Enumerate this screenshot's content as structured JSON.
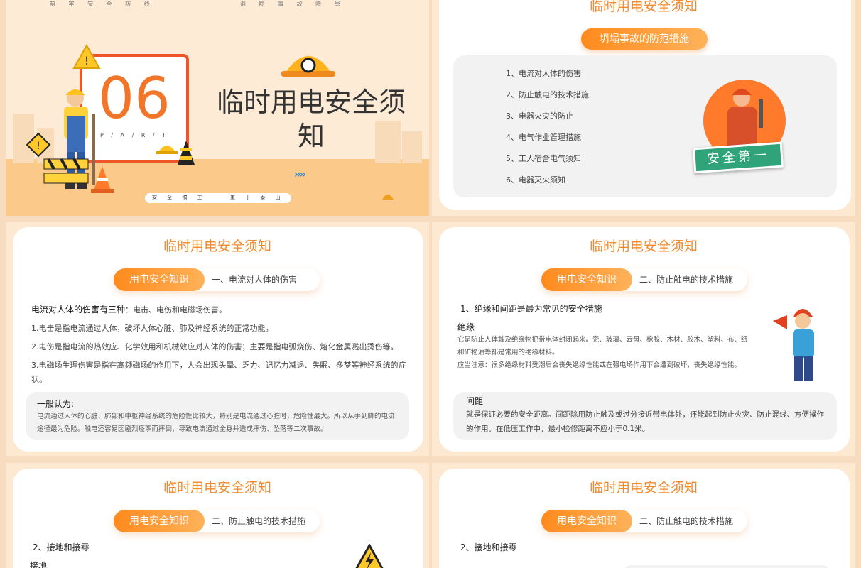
{
  "s1": {
    "top_left": "筑 牢 安 全 防 线",
    "top_right": "消 除 事 故 隐 患",
    "number": "06",
    "part": "P / A / R / T",
    "title": "临时用电安全须知",
    "bottom_left": "安 全 搞 工",
    "bottom_right": "重 于 泰 山"
  },
  "s2": {
    "title": "临时用电安全须知",
    "pill": "坍塌事故的防范措施",
    "items": [
      "1、电流对人体的伤害",
      "2、防止触电的技术措施",
      "3、电器火灾的防止",
      "4、电气作业管理措施",
      "5、工人宿舍电气须知",
      "6、电器灭火须知"
    ],
    "sign": "安全第一"
  },
  "s3": {
    "title": "临时用电安全须知",
    "pill": "用电安全知识",
    "pill_sub": "一、电流对人体的伤害",
    "lead_bold": "电流对人体的伤害有三种",
    "lead_rest": "：电击、电伤和电磁场伤害。",
    "p1": "1.电击是指电流通过人体，破坏人体心脏、肺及神经系统的正常功能。",
    "p2": "2.电伤是指电流的热效应、化学效用和机械效应对人体的伤害；主要是指电弧烧伤、熔化金属溅出烫伤等。",
    "p3": "3.电磁场生理伤害是指在高频磁场的作用下，人会出现头晕、乏力、记忆力减退、失眠、多梦等神经系统的症状。",
    "box_title": "一般认为:",
    "box_text": "电流通过人体的心脏、肺部和中枢神经系统的危险性比较大，特别是电流通过心脏时，危险性最大。所以从手到脚的电流途径最为危险。触电还容易因剧烈痉挛而摔倒，导致电流通过全身并造成摔伤、坠落等二次事故。"
  },
  "s4": {
    "title": "临时用电安全须知",
    "pill": "用电安全知识",
    "pill_sub": "二、防止触电的技术措施",
    "heading": "1、绝缘和间距是最为常见的安全措施",
    "sub1": "绝缘",
    "t1": "它是防止人体触及绝缘物把带电体封闭起来。瓷、玻璃、云母、橡胶、木材、胶木、塑料、布、纸和矿物油等都是常用的绝缘材料。",
    "t2": "应当注意：很多绝缘材料受潮后会丧失绝缘性能或在强电场作用下会遭到破坏，丧失绝缘性能。",
    "sub2": "间距",
    "t3": "就是保证必要的安全距离。间距除用防止触及或过分接近带电体外，还能起到防止火灾、防止混线、方便操作的作用。在低压工作中，最小检修距离不应小于0.1米。"
  },
  "s5": {
    "title": "临时用电安全须知",
    "pill": "用电安全知识",
    "pill_sub": "二、防止触电的技术措施",
    "heading": "2、接地和接零",
    "sub": "接地"
  },
  "s6": {
    "title": "临时用电安全须知",
    "pill": "用电安全知识",
    "pill_sub": "二、防止触电的技术措施",
    "heading": "2、接地和接零"
  },
  "colors": {
    "accent": "#f08a2c",
    "orange": "#ff8a1d",
    "bg": "#fde8d2"
  },
  "icons": [
    "hard-hat-icon",
    "warning-sign-icon",
    "traffic-cone-icon",
    "worker-illustration",
    "electric-warning-icon"
  ]
}
